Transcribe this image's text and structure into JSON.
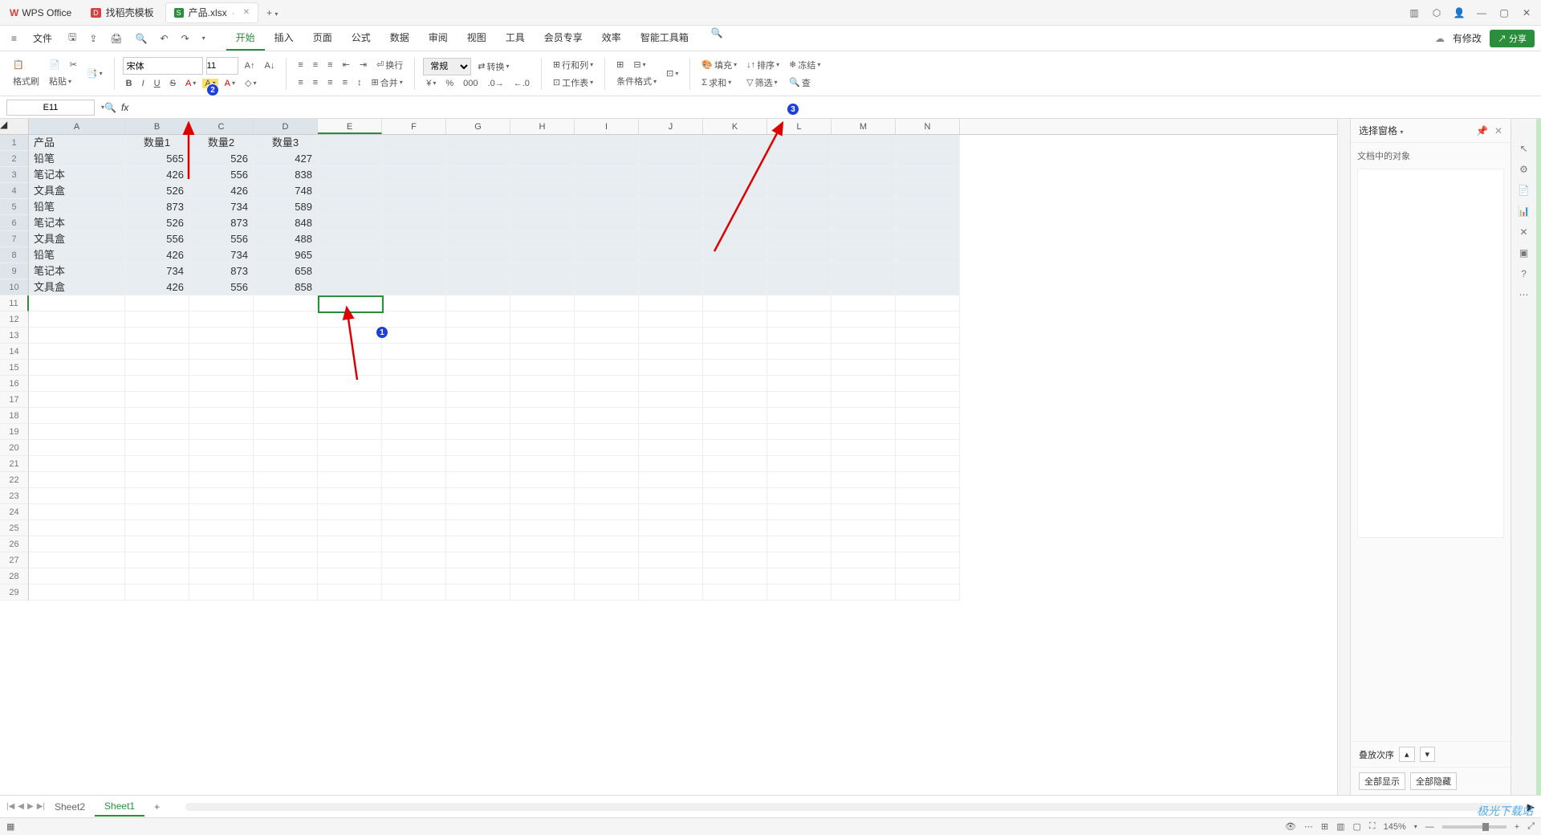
{
  "app": {
    "name": "WPS Office"
  },
  "tabs": [
    {
      "icon": "D",
      "icon_color": "#d54040",
      "label": "找稻壳模板"
    },
    {
      "icon": "S",
      "icon_color": "#2a8e3c",
      "label": "产品.xlsx",
      "dirty": "·",
      "active": true
    }
  ],
  "window": {
    "min": "—",
    "max": "▢",
    "close": "✕"
  },
  "file_menu": "文件",
  "menu": [
    "开始",
    "插入",
    "页面",
    "公式",
    "数据",
    "审阅",
    "视图",
    "工具",
    "会员专享",
    "效率",
    "智能工具箱"
  ],
  "menu_active": 0,
  "top_right": {
    "modify": "有修改",
    "share": "分享"
  },
  "ribbon": {
    "format_brush": "格式刷",
    "paste": "粘贴",
    "font": "宋体",
    "size": "11",
    "bold": "B",
    "italic": "I",
    "underline": "U",
    "strike": "S",
    "wrap": "换行",
    "merge": "合并",
    "normal": "常规",
    "convert": "转换",
    "row_col": "行和列",
    "worksheet": "工作表",
    "cond_fmt": "条件格式",
    "fill": "填充",
    "sort": "排序",
    "freeze": "冻结",
    "sum": "求和",
    "filter": "筛选",
    "find": "查"
  },
  "formula": {
    "cell_ref": "E11",
    "fx": "fx"
  },
  "columns": [
    "A",
    "B",
    "C",
    "D",
    "E",
    "F",
    "G",
    "H",
    "I",
    "J",
    "K",
    "L",
    "M",
    "N"
  ],
  "row_count": 29,
  "chart_data": {
    "type": "table",
    "headers": [
      "产品",
      "数量1",
      "数量2",
      "数量3"
    ],
    "rows": [
      [
        "铅笔",
        565,
        526,
        427
      ],
      [
        "笔记本",
        426,
        556,
        838
      ],
      [
        "文具盒",
        526,
        426,
        748
      ],
      [
        "铅笔",
        873,
        734,
        589
      ],
      [
        "笔记本",
        526,
        873,
        848
      ],
      [
        "文具盒",
        556,
        556,
        488
      ],
      [
        "铅笔",
        426,
        734,
        965
      ],
      [
        "笔记本",
        734,
        873,
        658
      ],
      [
        "文具盒",
        426,
        556,
        858
      ]
    ]
  },
  "side": {
    "title": "选择窗格",
    "doc_obj": "文档中的对象",
    "stack": "叠放次序",
    "show_all": "全部显示",
    "hide_all": "全部隐藏",
    "collapse": "—",
    "close": "✕"
  },
  "sheets": {
    "items": [
      "Sheet2",
      "Sheet1"
    ],
    "active": 1,
    "add": "+"
  },
  "status": {
    "zoom": "145%",
    "min": "—",
    "plus": "+"
  },
  "badges": {
    "b1": "1",
    "b2": "2",
    "b3": "3"
  },
  "watermark": "极光下载站"
}
